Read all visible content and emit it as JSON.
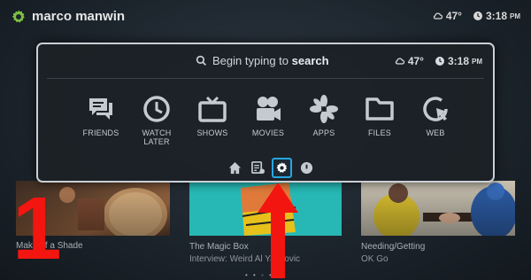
{
  "topbar": {
    "user_name": "marco manwin",
    "temperature": "47°",
    "time": "3:18",
    "ampm": "PM",
    "icons": [
      "gear-logo-icon",
      "cloud-icon",
      "clock-icon"
    ]
  },
  "overlay": {
    "search_text": "Begin typing to",
    "search_bold": "search",
    "temperature": "47°",
    "time": "3:18",
    "ampm": "PM",
    "menu": [
      {
        "label": "FRIENDS",
        "icon": "friends-icon"
      },
      {
        "label": "WATCH\nLATER",
        "icon": "clock-icon"
      },
      {
        "label": "SHOWS",
        "icon": "tv-icon"
      },
      {
        "label": "MOVIES",
        "icon": "movie-camera-icon"
      },
      {
        "label": "APPS",
        "icon": "apps-icon"
      },
      {
        "label": "FILES",
        "icon": "folder-icon"
      },
      {
        "label": "WEB",
        "icon": "web-icon"
      }
    ],
    "bottom_icons": [
      "home-icon",
      "queue-icon",
      "settings-icon",
      "power-icon"
    ],
    "selected_bottom": "settings-icon",
    "accent_color": "#27a6e0"
  },
  "tiles": [
    {
      "title": "Make",
      "title_suffix": "of a Shade",
      "subtitle": ""
    },
    {
      "title": "The Magic Box",
      "subtitle": "Interview: Weird Al Yankovic"
    },
    {
      "title": "Needing/Getting",
      "subtitle": "OK Go"
    }
  ],
  "page_dots": "• • ◦ •",
  "annotation": {
    "number": "1",
    "color": "#f3150f"
  }
}
